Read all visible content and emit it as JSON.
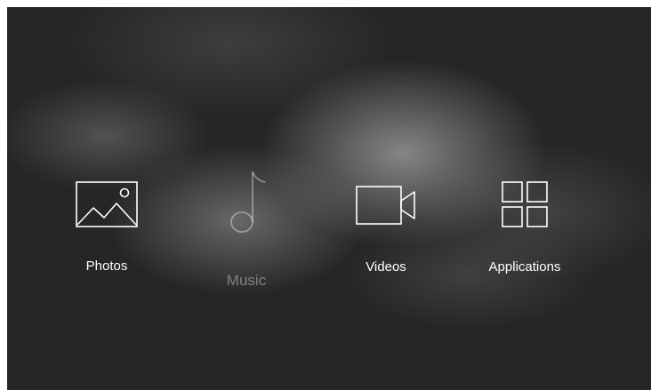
{
  "menu": {
    "items": [
      {
        "label": "Photos",
        "icon": "photo-icon",
        "focused": false
      },
      {
        "label": "Music",
        "icon": "music-note-icon",
        "focused": true
      },
      {
        "label": "Videos",
        "icon": "video-camera-icon",
        "focused": false
      },
      {
        "label": "Applications",
        "icon": "apps-grid-icon",
        "focused": false
      }
    ]
  }
}
